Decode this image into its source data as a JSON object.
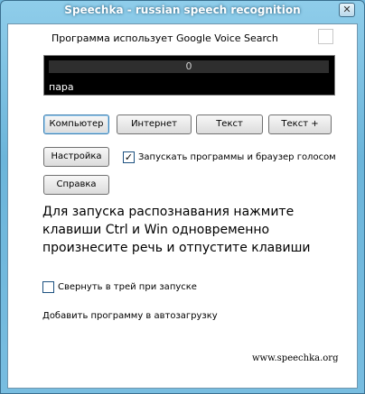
{
  "window": {
    "title": "Speechka - russian speech recognition",
    "close": "✕"
  },
  "info": {
    "text": "Программа использует Google Voice Search"
  },
  "display": {
    "level": "0",
    "text": "пара"
  },
  "buttons": {
    "computer": "Компьютер",
    "internet": "Интернет",
    "text": "Текст",
    "text_plus": "Текст +",
    "settings": "Настройка",
    "help": "Справка"
  },
  "options": {
    "launch_by_voice": {
      "label": "Запускать программы и браузер голосом",
      "checked": true
    },
    "tray_on_start": {
      "label": "Свернуть в трей при запуске",
      "checked": false
    }
  },
  "instructions": "Для запуска распознавания нажмите клавиши Ctrl и Win одновременно произнесите речь и отпустите клавиши",
  "autostart_link": "Добавить программу в автозагрузку",
  "website": "www.speechka.org"
}
